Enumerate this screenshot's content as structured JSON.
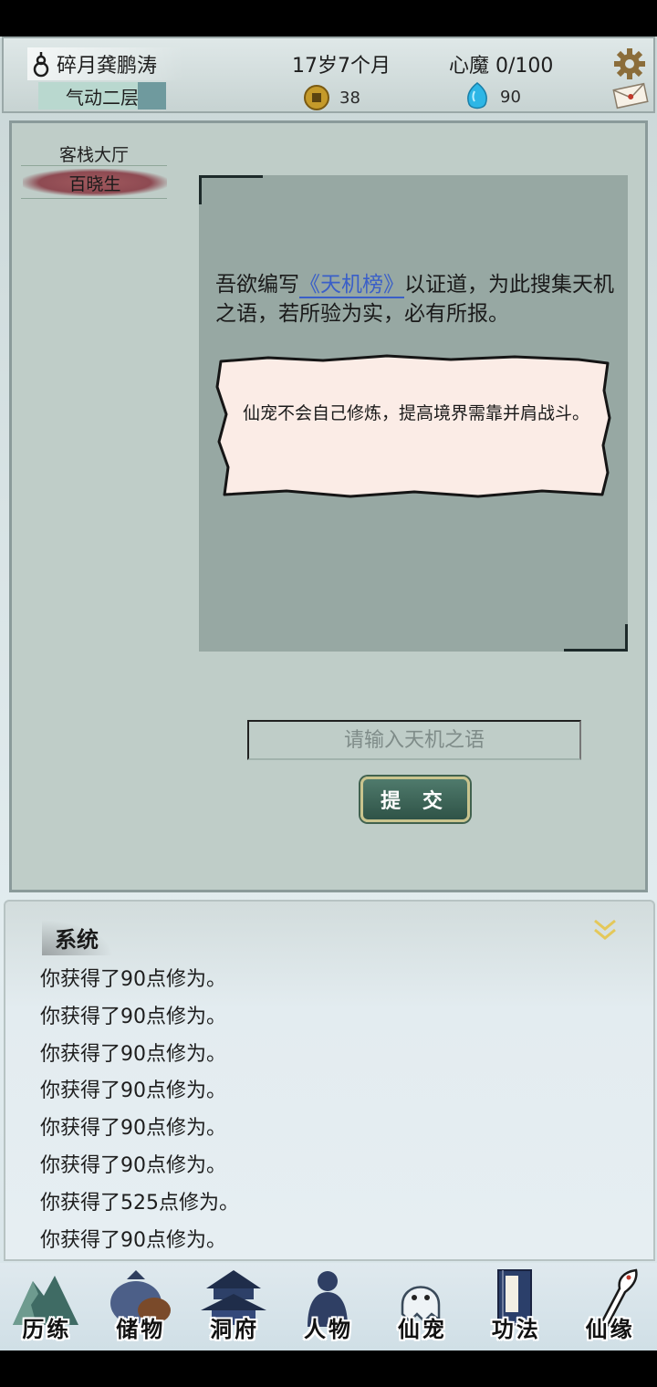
{
  "header": {
    "player_name": "碎月龚鹏涛",
    "realm": "气动二层",
    "age": "17岁7个月",
    "heart_demon": "心魔 0/100",
    "coins": "38",
    "spirit_stones": "90",
    "icons": {
      "gourd": "gourd-icon",
      "coin": "coin-icon",
      "stone": "spirit-stone-icon",
      "settings": "gear-icon",
      "mail": "letter-icon"
    }
  },
  "location": {
    "place": "客栈大厅",
    "npc": "百晓生"
  },
  "dialog": {
    "text_before": "吾欲编写",
    "link": "《天机榜》",
    "text_after": "以证道，为此搜集天机之语，若所验为实，必有所报。",
    "tip": "仙宠不会自己修炼，提高境界需靠并肩战斗。"
  },
  "input": {
    "placeholder": "请输入天机之语",
    "value": ""
  },
  "submit_label": "提 交",
  "log": {
    "title": "系统",
    "lines": [
      "你获得了90点修为。",
      "你获得了90点修为。",
      "你获得了90点修为。",
      "你获得了90点修为。",
      "你获得了90点修为。",
      "你获得了90点修为。",
      "你获得了525点修为。",
      "你获得了90点修为。"
    ]
  },
  "nav": [
    {
      "label": "历练",
      "icon": "mountain-icon"
    },
    {
      "label": "储物",
      "icon": "bag-icon"
    },
    {
      "label": "洞府",
      "icon": "pavilion-icon"
    },
    {
      "label": "人物",
      "icon": "figure-icon"
    },
    {
      "label": "仙宠",
      "icon": "ghost-pet-icon"
    },
    {
      "label": "功法",
      "icon": "scroll-book-icon"
    },
    {
      "label": "仙缘",
      "icon": "crane-icon"
    }
  ],
  "colors": {
    "panel": "#bfcdc8",
    "dialog": "#97a8a3",
    "link": "#3a5fc8",
    "button": "#3a6153",
    "button_border": "#c9c48e",
    "npc_tag": "#8e4a52"
  }
}
